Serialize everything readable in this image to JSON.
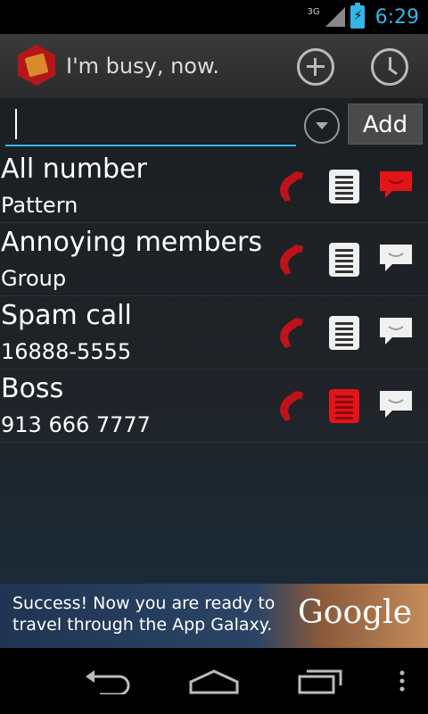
{
  "status_bar": {
    "network": "3G",
    "time": "6:29",
    "icons": [
      "signal-icon",
      "battery-charging-icon"
    ]
  },
  "action_bar": {
    "title": "I'm busy, now.",
    "actions": [
      "add-icon",
      "history-icon"
    ]
  },
  "input": {
    "value": "",
    "placeholder": "",
    "add_label": "Add"
  },
  "entries": [
    {
      "name": "All number",
      "detail": "Pattern",
      "call_blocked": true,
      "sms_log_highlight": false,
      "reply_highlight": true
    },
    {
      "name": "Annoying members",
      "detail": "Group",
      "call_blocked": true,
      "sms_log_highlight": false,
      "reply_highlight": false
    },
    {
      "name": "Spam call",
      "detail": "16888-5555",
      "call_blocked": true,
      "sms_log_highlight": false,
      "reply_highlight": false
    },
    {
      "name": "Boss",
      "detail": "913 666 7777",
      "call_blocked": true,
      "sms_log_highlight": true,
      "reply_highlight": false
    }
  ],
  "ad": {
    "text": "Success! Now you are ready to travel through the App Galaxy.",
    "brand": "Google"
  },
  "colors": {
    "accent": "#33b5e5",
    "active_red": "#e3131a",
    "inactive_white": "#f0f0f0"
  }
}
